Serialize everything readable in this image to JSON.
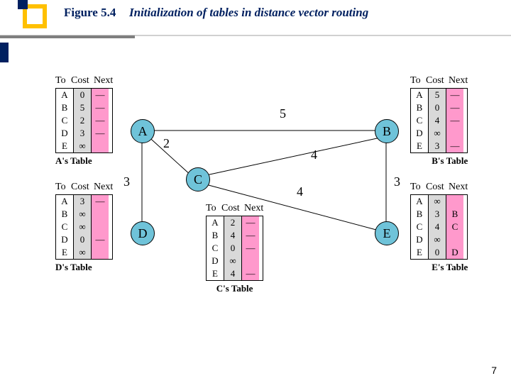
{
  "header": {
    "figure_no": "Figure 5.4",
    "title": "Initialization of tables in distance vector routing"
  },
  "tables": {
    "A": {
      "caption": "A's Table",
      "headers": [
        "To",
        "Cost",
        "Next"
      ],
      "to": [
        "A",
        "B",
        "C",
        "D",
        "E"
      ],
      "cost": [
        "0",
        "5",
        "2",
        "3",
        "∞"
      ],
      "next": [
        "—",
        "—",
        "—",
        "—",
        ""
      ]
    },
    "B": {
      "caption": "B's Table",
      "headers": [
        "To",
        "Cost",
        "Next"
      ],
      "to": [
        "A",
        "B",
        "C",
        "D",
        "E"
      ],
      "cost": [
        "5",
        "0",
        "4",
        "∞",
        "3"
      ],
      "next": [
        "—",
        "—",
        "—",
        "",
        "—"
      ]
    },
    "C": {
      "caption": "C's Table",
      "headers": [
        "To",
        "Cost",
        "Next"
      ],
      "to": [
        "A",
        "B",
        "C",
        "D",
        "E"
      ],
      "cost": [
        "2",
        "4",
        "0",
        "∞",
        "4"
      ],
      "next": [
        "—",
        "—",
        "—",
        "",
        "—"
      ]
    },
    "D": {
      "caption": "D's Table",
      "headers": [
        "To",
        "Cost",
        "Next"
      ],
      "to": [
        "A",
        "B",
        "C",
        "D",
        "E"
      ],
      "cost": [
        "3",
        "∞",
        "∞",
        "0",
        "∞"
      ],
      "next": [
        "—",
        "",
        "",
        "—",
        ""
      ]
    },
    "E": {
      "caption": "E's Table",
      "headers": [
        "To",
        "Cost",
        "Next"
      ],
      "to": [
        "A",
        "B",
        "C",
        "D",
        "E"
      ],
      "cost": [
        "∞",
        "3",
        "4",
        "∞",
        "0"
      ],
      "next": [
        "",
        "B",
        "C",
        "",
        "D"
      ]
    }
  },
  "nodes": {
    "A": "A",
    "B": "B",
    "C": "C",
    "D": "D",
    "E": "E"
  },
  "edge_weights": {
    "AB": "5",
    "AC": "2",
    "AD": "3",
    "BC": "4",
    "BE": "3",
    "CE": "4"
  },
  "page_number": "7"
}
